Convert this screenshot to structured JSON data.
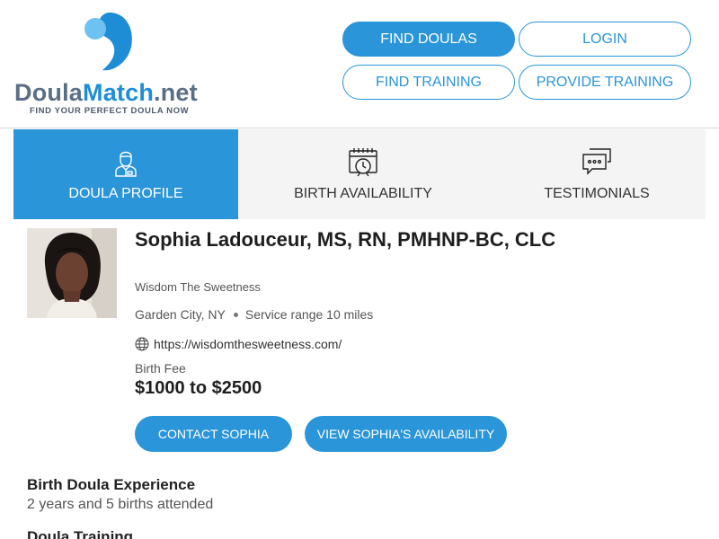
{
  "logo": {
    "name_part1": "Doula",
    "name_part2": "Match",
    "name_part3": ".net",
    "tagline": "FIND YOUR PERFECT DOULA NOW"
  },
  "nav": {
    "find_doulas": "FIND DOULAS",
    "login": "LOGIN",
    "find_training": "FIND TRAINING",
    "provide_training": "PROVIDE TRAINING"
  },
  "tabs": [
    {
      "label": "DOULA PROFILE",
      "icon": "profile-icon",
      "active": true
    },
    {
      "label": "BIRTH AVAILABILITY",
      "icon": "calendar-clock-icon",
      "active": false
    },
    {
      "label": "TESTIMONIALS",
      "icon": "chat-bubbles-icon",
      "active": false
    }
  ],
  "profile": {
    "name": "Sophia Ladouceur, MS, RN, PMHNP-BC, CLC",
    "business": "Wisdom The Sweetness",
    "city": "Garden City, NY",
    "service_range": "Service range 10 miles",
    "website": "https://wisdomthesweetness.com/",
    "fee_label": "Birth Fee",
    "fee_value": "$1000 to $2500",
    "contact_button": "CONTACT SOPHIA",
    "availability_button": "VIEW SOPHIA'S AVAILABILITY"
  },
  "experience": {
    "title": "Birth Doula Experience",
    "text": "2 years and 5 births attended"
  },
  "training": {
    "title": "Doula Training"
  },
  "colors": {
    "brand_blue": "#2a95d9",
    "logo_gray": "#5a6f86",
    "tab_bg": "#f4f4f4"
  }
}
